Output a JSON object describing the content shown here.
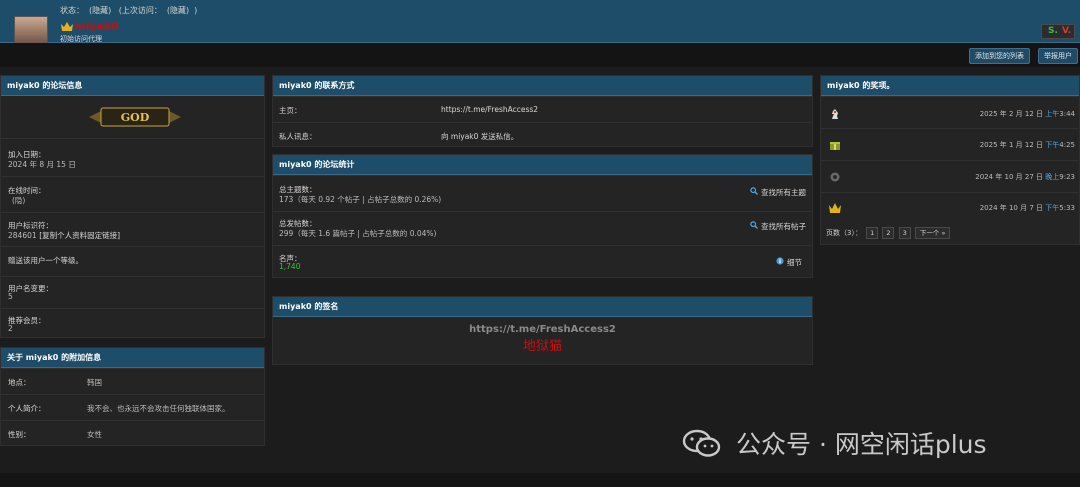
{
  "header": {
    "username": "miyak0",
    "user_title": "初始访问代理",
    "status_label": "状态：",
    "status_value": "(隐藏)",
    "last_visit_label": "(上次访问：",
    "last_visit_value": "(隐藏)",
    "last_visit_close": ")",
    "social_s": "S.",
    "social_v": "V.",
    "add_contact_label": "添加到您的列表",
    "report_label": "举报用户"
  },
  "forum_info": {
    "title": "miyak0 的论坛信息",
    "badge_text": "GOD",
    "join_label": "加入日期：",
    "join_value": "2024 年 8 月 15 日",
    "online_label": "在线时间：",
    "online_value": "(隐)",
    "user_id_label": "用户标识符：",
    "user_id_value": "284601",
    "copy_link_label": "[复制个人资料固定链接]",
    "rate_label": "赠送该用户一个等级。",
    "rename_label": "用户名变更：",
    "rename_value": "5",
    "referrals_label": "推荐会员：",
    "referrals_value": "2"
  },
  "extra_info": {
    "title": "关于 miyak0 的附加信息",
    "location_label": "地点：",
    "location_value": "韩国",
    "bio_label": "个人简介：",
    "bio_value": "我不会、也永远不会攻击任何独联体国家。",
    "gender_label": "性别：",
    "gender_value": "女性"
  },
  "contact": {
    "title": "miyak0 的联系方式",
    "homepage_label": "主页：",
    "homepage_value": "https://t.me/FreshAccess2",
    "pm_label": "私人讯息：",
    "pm_value": "向 miyak0 发送私信。"
  },
  "stats": {
    "title": "miyak0 的论坛统计",
    "threads_label": "总主题数：",
    "threads_value": "173（每天 0.92 个帖子 | 占帖子总数的 0.26%)",
    "threads_link": "查找所有主题",
    "posts_label": "总发帖数：",
    "posts_value": "299（每天 1.6 篇帖子 | 占帖子总数的 0.04%)",
    "posts_link": "查找所有帖子",
    "rep_label": "名声：",
    "rep_value": "1,740",
    "details_link": "细节"
  },
  "signature": {
    "title": "miyak0 的签名",
    "url": "https://t.me/FreshAccess2",
    "name": "地狱猫"
  },
  "awards": {
    "title": "miyak0 的奖项。",
    "items": [
      {
        "icon": "chess-knight-icon",
        "date": "2025 年 2 月 12 日",
        "ampm": "上午",
        "time": "3:44"
      },
      {
        "icon": "gift-icon",
        "date": "2025 年 1 月 12 日",
        "ampm": "下午",
        "time": "4:25"
      },
      {
        "icon": "gear-medal-icon",
        "date": "2024 年 10 月 27 日",
        "ampm": "晚上",
        "time": "9:23"
      },
      {
        "icon": "crown-icon",
        "date": "2024 年 10 月 7 日",
        "ampm": "下午",
        "time": "5:33"
      }
    ],
    "pages_label": "页数（3）：",
    "pages": [
      "1",
      "2",
      "3"
    ],
    "next_label": "下一个 »"
  },
  "watermark": {
    "text": "公众号 · 网空闲话plus"
  },
  "colors": {
    "header_bg": "#1d4d68",
    "username": "#c01010",
    "reputation": "#3dc23d",
    "time_link": "#56a6e0"
  }
}
